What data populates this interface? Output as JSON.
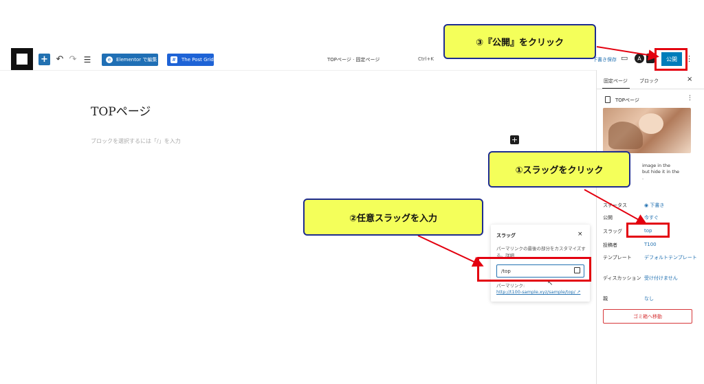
{
  "toolbar": {
    "undo_icon": "↶",
    "redo_icon": "↷",
    "list_icon": "☰",
    "elementor_label": "Elementor で編集",
    "elementor_icon": "e",
    "postgrid_label": "The Post Grid",
    "postgrid_icon": "#",
    "document_title": "TOPページ · 固定ページ",
    "shortcut": "Ctrl+K",
    "save_draft": "下書き保存",
    "avatar_letter": "A",
    "publish_label": "公開",
    "more_icon": "⋮"
  },
  "editor": {
    "page_title": "TOPページ",
    "block_placeholder": "ブロックを選択するには「/」を入力",
    "add_block_icon": "+"
  },
  "slug_popover": {
    "title": "スラッグ",
    "close_icon": "×",
    "description": "パーマリンクの最後の部分をカスタマイズする。詳細",
    "slug_value": "/top",
    "permalink_label": "パーマリンク:",
    "permalink_url": "http://t100-sample.xyz/sample/top/ ↗"
  },
  "sidebar": {
    "tab_page": "固定ページ",
    "tab_block": "ブロック",
    "close_icon": "×",
    "doc_name": "TOPページ",
    "more_icon": "⋮",
    "image_note": "image in the\n but hide it in the\n.",
    "rows": [
      {
        "label": "ステータス",
        "value": "◉ 下書き"
      },
      {
        "label": "公開",
        "value": "今すぐ"
      },
      {
        "label": "スラッグ",
        "value": "top"
      },
      {
        "label": "投稿者",
        "value": "T100"
      },
      {
        "label": "テンプレート",
        "value": "デフォルトテンプレート"
      },
      {
        "label": "ディスカッション",
        "value": "受け付けません"
      },
      {
        "label": "親",
        "value": "なし"
      }
    ],
    "trash_label": "ゴミ箱へ移動"
  },
  "annotations": {
    "step1": "①スラッグをクリック",
    "step2": "②任意スラッグを入力",
    "step3": "③『公開』をクリック"
  },
  "colors": {
    "callout_bg": "#f4ff5a",
    "callout_border": "#1d2b8f",
    "highlight_red": "#e3000f",
    "wp_blue": "#007cba"
  }
}
